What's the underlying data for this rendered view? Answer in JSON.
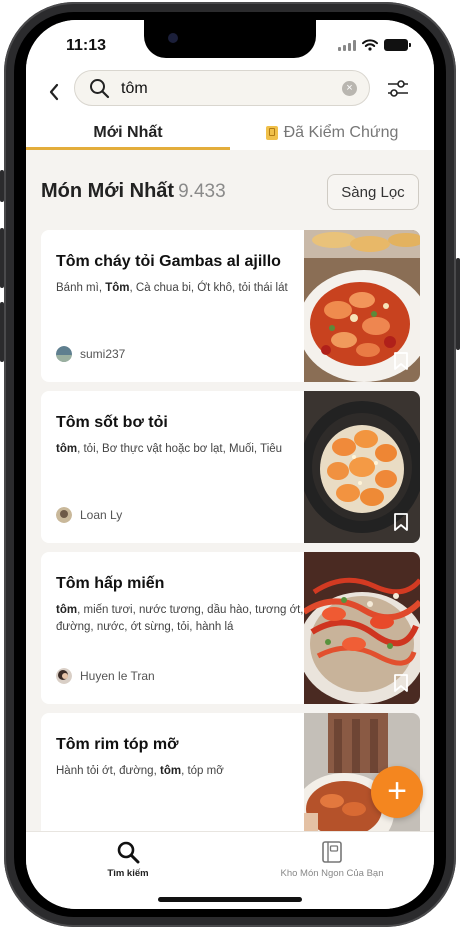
{
  "status_bar": {
    "time": "11:13"
  },
  "search": {
    "value": "tôm",
    "placeholder": ""
  },
  "tabs": [
    {
      "label": "Mới Nhất",
      "active": true
    },
    {
      "label": "Đã Kiểm Chứng",
      "active": false
    }
  ],
  "section": {
    "title": "Món Mới Nhất",
    "count": "9.433",
    "filter_label": "Sàng Lọc"
  },
  "recipes": [
    {
      "title": "Tôm cháy tỏi Gambas al ajillo",
      "ingredients_html": "Bánh mì, <b>Tôm</b>, Cà chua bi, Ớt khô, tỏi thái lát",
      "author": "sumi237"
    },
    {
      "title": "Tôm sốt bơ tỏi",
      "ingredients_html": "<b>tôm</b>, tỏi, Bơ thực vật hoặc bơ lạt, Muối, Tiêu",
      "author": "Loan Ly"
    },
    {
      "title": "Tôm hấp miến",
      "ingredients_html": "<b>tôm</b>, miến tươi, nước tương, dầu hào, tương ớt, đường, nước, ớt sừng, tỏi, hành lá",
      "author": "Huyen le Tran"
    },
    {
      "title": "Tôm rim tóp mỡ",
      "ingredients_html": "Hành tỏi ớt, đường, <b>tôm</b>, tóp mỡ",
      "author": ""
    }
  ],
  "bottom_nav": [
    {
      "label": "Tìm kiếm",
      "icon": "search-icon",
      "active": true
    },
    {
      "label": "Kho Món Ngon Của Bạn",
      "icon": "recipe-book-icon",
      "active": false
    }
  ],
  "colors": {
    "accent": "#e3ad3b",
    "fab": "#f4861f",
    "background": "#f5f3f0"
  }
}
